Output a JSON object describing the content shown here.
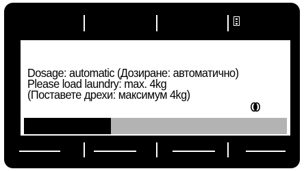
{
  "display": {
    "lines": [
      "Dosage: automatic (Дозиране: автоматично)",
      "Please load laundry: max. 4kg",
      "(Поставете дрехи: максимум 4kg)"
    ],
    "load_icon": "laundry-load-icon",
    "progress_fraction": 0.33
  },
  "top_bar": {
    "menu_icon": "menu-list-icon"
  },
  "colors": {
    "frame": "#000000",
    "screen": "#ffffff",
    "progress_track": "#b3b3b3",
    "progress_fill": "#000000"
  }
}
